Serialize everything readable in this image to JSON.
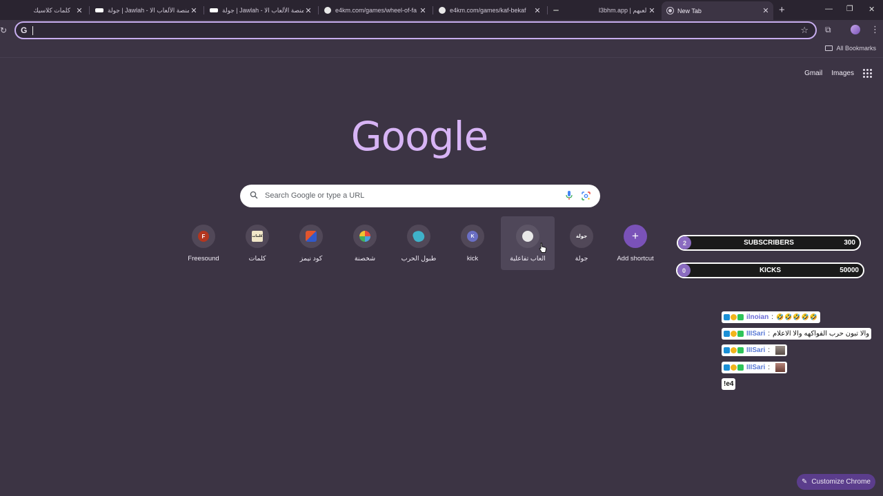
{
  "tabs": [
    {
      "title": "كلمات كلاسيك",
      "favicon_color": "#2a2430",
      "active": false
    },
    {
      "title": "جولة | Jawlah - منصة الألعاب الا",
      "favicon_color": "#ffffff",
      "active": false
    },
    {
      "title": "جولة | Jawlah - منصة الألعاب الا",
      "favicon_color": "#ffffff",
      "active": false
    },
    {
      "title": "e4km.com/games/wheel-of-fa",
      "favicon_color": "#e8e8e8",
      "active": false
    },
    {
      "title": "e4km.com/games/kaf-bekaf",
      "favicon_color": "#e8e8e8",
      "active": false
    },
    {
      "title": "",
      "favicon_color": "#8a8a8a",
      "active": false
    },
    {
      "title": "l3bhm.app | لعبهم",
      "favicon_color": "#2a2430",
      "active": false
    },
    {
      "title": "New Tab",
      "favicon_color": "#cfc8d6",
      "active": true
    }
  ],
  "toolbar": {
    "omnibox_value": "",
    "all_bookmarks": "All Bookmarks"
  },
  "header": {
    "gmail": "Gmail",
    "images": "Images"
  },
  "logo_text": "Google",
  "search": {
    "placeholder": "Search Google or type a URL"
  },
  "shortcuts": [
    {
      "label": "Freesound",
      "icon_text": "F",
      "icon_color": "#b3361f"
    },
    {
      "label": "كلمات",
      "icon_text": "كلمات",
      "icon_color": "#f1e7c8"
    },
    {
      "label": "كود نيمز",
      "icon_text": "",
      "icon_color": "#e0552e"
    },
    {
      "label": "شخصنة",
      "icon_text": "",
      "icon_color": "#4aa3df"
    },
    {
      "label": "طبول الحرب",
      "icon_text": "",
      "icon_color": "#3fb2c9"
    },
    {
      "label": "kick",
      "icon_text": "K",
      "icon_color": "#6a6fc4"
    },
    {
      "label": "العاب تفاعلية",
      "icon_text": "",
      "icon_color": "#e8e8e8"
    },
    {
      "label": "جولة",
      "icon_text": "جولة",
      "icon_color": "#514858"
    },
    {
      "label": "Add shortcut",
      "icon_text": "+",
      "icon_color": "#7a52b8"
    }
  ],
  "overlay": {
    "counters": [
      {
        "name": "SUBSCRIBERS",
        "current": "2",
        "goal": "300"
      },
      {
        "name": "KICKS",
        "current": "0",
        "goal": "50000"
      }
    ],
    "chat": [
      {
        "user": "ilnoian",
        "message": "🤣🤣🤣🤣🤣"
      },
      {
        "user": "IIISari",
        "message": "والا تبون حرب الفواكهه والا الاعلام"
      },
      {
        "user": "IIISari",
        "message": ""
      },
      {
        "user": "IIISari",
        "message": ""
      },
      {
        "user": "",
        "message": "!e4"
      }
    ]
  },
  "customize_label": "Customize Chrome",
  "colors": {
    "background": "#3c3444",
    "logo": "#d7b4f5",
    "accent": "#7a52b8"
  }
}
